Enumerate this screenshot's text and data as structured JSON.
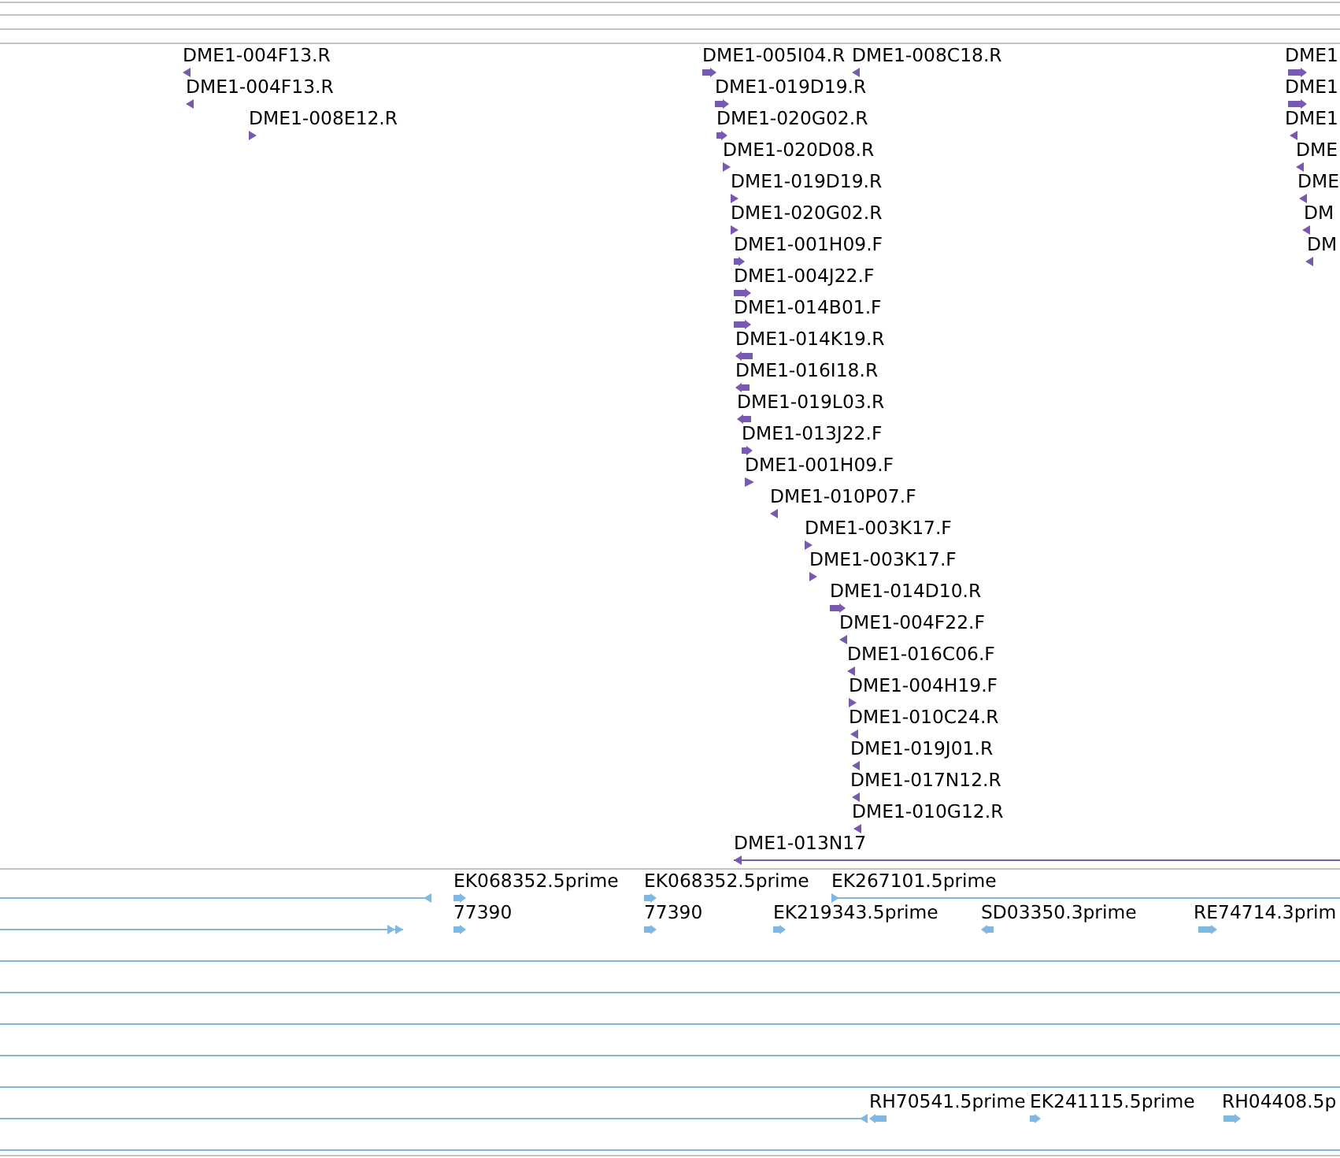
{
  "tracks": [
    {
      "kind": "empty"
    },
    {
      "kind": "empty"
    },
    {
      "kind": "empty"
    },
    {
      "kind": "features",
      "color": "#7759b0",
      "features": [
        {
          "kind": "arrow",
          "label": "DME1-004F13.R",
          "reverse": true
        },
        {
          "kind": "arrow",
          "label": "DME1-005I04.R",
          "reverse": false
        },
        {
          "kind": "arrow",
          "label": "DME1-008C18.R",
          "reverse": true
        },
        {
          "kind": "arrow",
          "label": "DME1",
          "reverse": false
        },
        {
          "kind": "arrow",
          "label": "DME1-004F13.R",
          "reverse": true
        },
        {
          "kind": "arrow",
          "label": "DME1-019D19.R",
          "reverse": false
        },
        {
          "kind": "arrow",
          "label": "DME1",
          "reverse": false
        },
        {
          "kind": "arrow",
          "label": "DME1-008E12.R",
          "reverse": false
        },
        {
          "kind": "arrow",
          "label": "DME1-020G02.R",
          "reverse": false
        },
        {
          "kind": "arrow",
          "label": "DME1",
          "reverse": true
        },
        {
          "kind": "arrow",
          "label": "DME1-020D08.R",
          "reverse": false
        },
        {
          "kind": "arrow",
          "label": "DME",
          "reverse": true
        },
        {
          "kind": "arrow",
          "label": "DME1-019D19.R",
          "reverse": false
        },
        {
          "kind": "arrow",
          "label": "DME",
          "reverse": true
        },
        {
          "kind": "arrow",
          "label": "DME1-020G02.R",
          "reverse": false
        },
        {
          "kind": "arrow",
          "label": "DM",
          "reverse": true
        },
        {
          "kind": "arrow",
          "label": "DME1-001H09.F",
          "reverse": false
        },
        {
          "kind": "arrow",
          "label": "DM",
          "reverse": true
        },
        {
          "kind": "arrow",
          "label": "DME1-004J22.F",
          "reverse": false
        },
        {
          "kind": "arrow",
          "label": "DME1-014B01.F",
          "reverse": false
        },
        {
          "kind": "arrow",
          "label": "DME1-014K19.R",
          "reverse": true
        },
        {
          "kind": "arrow",
          "label": "DME1-016I18.R",
          "reverse": true
        },
        {
          "kind": "arrow",
          "label": "DME1-019L03.R",
          "reverse": true
        },
        {
          "kind": "arrow",
          "label": "DME1-013J22.F",
          "reverse": false
        },
        {
          "kind": "arrow",
          "label": "DME1-001H09.F",
          "reverse": false
        },
        {
          "kind": "arrow",
          "label": "DME1-010P07.F",
          "reverse": true
        },
        {
          "kind": "arrow",
          "label": "DME1-003K17.F",
          "reverse": false
        },
        {
          "kind": "arrow",
          "label": "DME1-003K17.F",
          "reverse": false
        },
        {
          "kind": "arrow",
          "label": "DME1-014D10.R",
          "reverse": false
        },
        {
          "kind": "arrow",
          "label": "DME1-004F22.F",
          "reverse": true
        },
        {
          "kind": "arrow",
          "label": "DME1-016C06.F",
          "reverse": true
        },
        {
          "kind": "arrow",
          "label": "DME1-004H19.F",
          "reverse": false
        },
        {
          "kind": "arrow",
          "label": "DME1-010C24.R",
          "reverse": true
        },
        {
          "kind": "arrow",
          "label": "DME1-019J01.R",
          "reverse": true
        },
        {
          "kind": "arrow",
          "label": "DME1-017N12.R",
          "reverse": true
        },
        {
          "kind": "arrow",
          "label": "DME1-010G12.R",
          "reverse": true
        },
        {
          "kind": "line",
          "label": "DME1-013N17",
          "reverse": true
        }
      ]
    },
    {
      "kind": "features",
      "color": "#7fb9e3",
      "features": [
        {
          "kind": "line",
          "reverse": true
        },
        {
          "kind": "arrow",
          "label": "EK068352.5prime",
          "reverse": false
        },
        {
          "kind": "arrow",
          "label": "EK068352.5prime",
          "reverse": false
        },
        {
          "kind": "line",
          "label": "EK267101.5prime",
          "reverse": false
        },
        {
          "kind": "line",
          "reverse": false
        },
        {
          "kind": "arrow",
          "label": "77390",
          "reverse": false
        },
        {
          "kind": "arrow",
          "label": "77390",
          "reverse": false
        },
        {
          "kind": "arrow",
          "label": "EK219343.5prime",
          "reverse": false
        },
        {
          "kind": "arrow",
          "label": "SD03350.3prime",
          "reverse": true
        },
        {
          "kind": "arrow",
          "label": "RE74714.3prim",
          "reverse": false
        },
        {
          "kind": "line"
        },
        {
          "kind": "line"
        },
        {
          "kind": "line"
        },
        {
          "kind": "line"
        },
        {
          "kind": "line"
        },
        {
          "kind": "line",
          "reverse": true
        },
        {
          "kind": "arrow",
          "label": "RH70541.5prime",
          "reverse": true
        },
        {
          "kind": "arrow",
          "label": "EK241115.5prime",
          "reverse": false
        },
        {
          "kind": "arrow",
          "label": "RH04408.5p",
          "reverse": false
        },
        {
          "kind": "line"
        }
      ]
    }
  ]
}
